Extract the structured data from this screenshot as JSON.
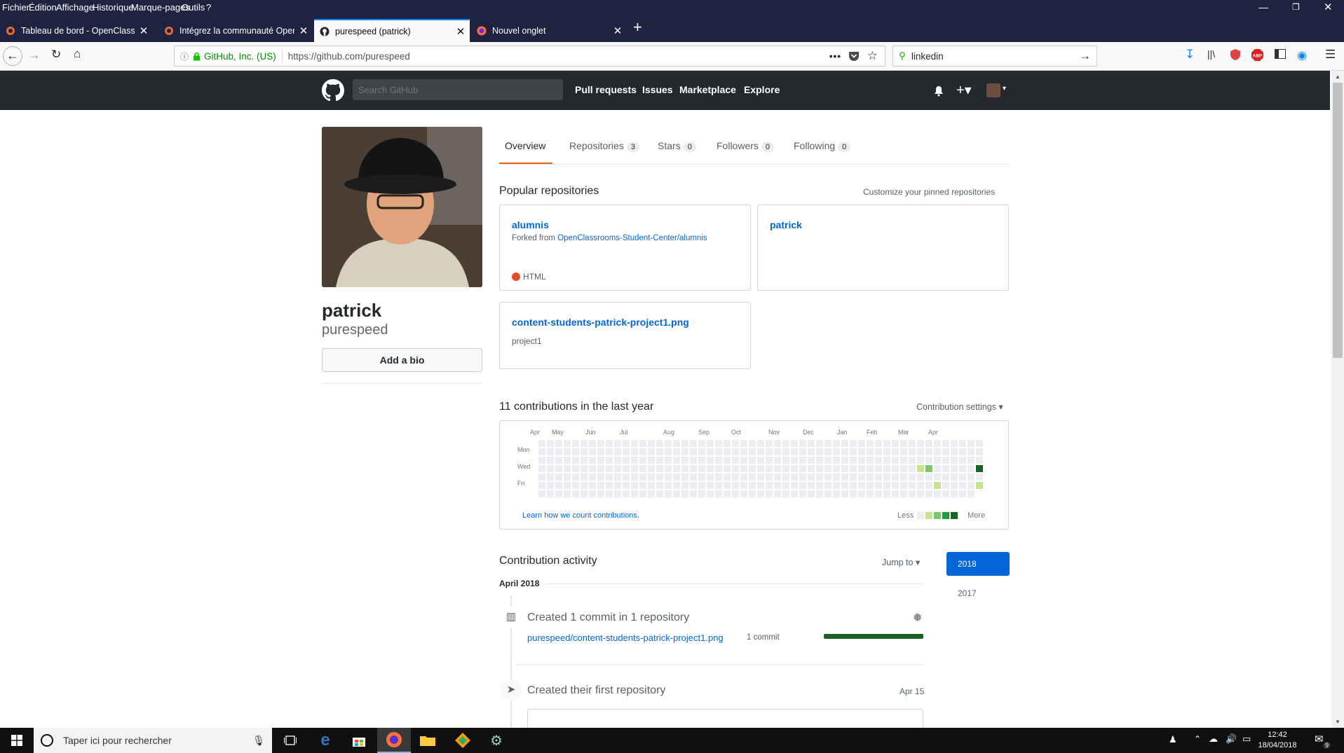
{
  "menubar": {
    "items": [
      "Fichier",
      "Édition",
      "Affichage",
      "Historique",
      "Marque-pages",
      "Outils",
      "?"
    ]
  },
  "tabs": [
    {
      "title": "Tableau de bord - OpenClassrooms"
    },
    {
      "title": "Intégrez la communauté OpenClassrooms"
    },
    {
      "title": "purespeed (patrick)"
    },
    {
      "title": "Nouvel onglet"
    }
  ],
  "urlbar": {
    "identity": "GitHub, Inc. (US)",
    "url": "https://github.com/purespeed"
  },
  "searchbar": {
    "value": "linkedin"
  },
  "github": {
    "search_placeholder": "Search GitHub",
    "nav": [
      "Pull requests",
      "Issues",
      "Marketplace",
      "Explore"
    ]
  },
  "profile": {
    "name": "patrick",
    "username": "purespeed",
    "bio_button": "Add a bio"
  },
  "profile_tabs": [
    {
      "label": "Overview",
      "count": ""
    },
    {
      "label": "Repositories",
      "count": "3"
    },
    {
      "label": "Stars",
      "count": "0"
    },
    {
      "label": "Followers",
      "count": "0"
    },
    {
      "label": "Following",
      "count": "0"
    }
  ],
  "popular": {
    "heading": "Popular repositories",
    "customize": "Customize your pinned repositories"
  },
  "repos": [
    {
      "name": "alumnis",
      "forked_prefix": "Forked from ",
      "forked_link": "OpenClassrooms-Student-Center/alumnis",
      "language": "HTML",
      "lang_color": "#e34c26"
    },
    {
      "name": "patrick"
    },
    {
      "name": "content-students-patrick-project1.png",
      "description": "project1"
    }
  ],
  "contrib": {
    "heading": "11 contributions in the last year",
    "settings": "Contribution settings",
    "months": [
      "Apr",
      "May",
      "Jun",
      "Jul",
      "Aug",
      "Sep",
      "Oct",
      "Nov",
      "Dec",
      "Jan",
      "Feb",
      "Mar",
      "Apr"
    ],
    "days": [
      "Mon",
      "Wed",
      "Fri"
    ],
    "learn": "Learn how we count contributions.",
    "less": "Less",
    "more": "More",
    "colors": [
      "#ebedf0",
      "#c6e48b",
      "#7bc96f",
      "#239a3b",
      "#196127"
    ]
  },
  "activity": {
    "heading": "Contribution activity",
    "jump": "Jump to",
    "years": [
      "2018",
      "2017"
    ],
    "month": "April 2018",
    "commit_title": "Created 1 commit in 1 repository",
    "commit_repo": "purespeed/content-students-patrick-project1.png",
    "commit_count": "1 commit",
    "first_repo": "Created their first repository",
    "first_date": "Apr 15"
  },
  "taskbar": {
    "search_placeholder": "Taper ici pour rechercher",
    "time": "12:42",
    "date": "18/04/2018",
    "notif": "9"
  }
}
